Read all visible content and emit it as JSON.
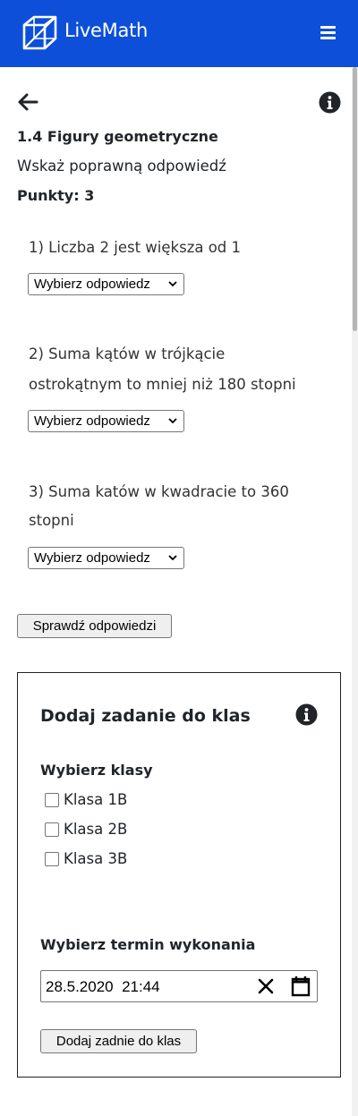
{
  "header": {
    "brand": "LiveMath"
  },
  "task": {
    "title": "1.4 Figury geometryczne",
    "instruction": "Wskaż poprawną odpowiedź",
    "points": "Punkty: 3"
  },
  "questions": [
    {
      "line1": "1) Liczba 2 jest większa od 1",
      "line2": "",
      "select": "Wybierz odpowiedz"
    },
    {
      "line1": "2) Suma kątów w trójkącie",
      "line2": "ostrokątnym to mniej niż 180 stopni",
      "select": "Wybierz odpowiedz"
    },
    {
      "line1": "3) Suma katów w kwadracie to 360",
      "line2": "stopni",
      "select": "Wybierz odpowiedz"
    }
  ],
  "check_button": "Sprawdź odpowiedzi",
  "assign": {
    "title": "Dodaj zadanie do klas",
    "classes_label": "Wybierz klasy",
    "classes": [
      {
        "label": "Klasa 1B",
        "checked": false
      },
      {
        "label": "Klasa 2B",
        "checked": false
      },
      {
        "label": "Klasa 3B",
        "checked": false
      }
    ],
    "deadline_label": "Wybierz termin wykonania",
    "deadline_value": "28.5.2020  21:44",
    "submit_button": "Dodaj zadnie do klas"
  },
  "colors": {
    "header_bg": "#0d4fd9",
    "text": "#212529"
  },
  "icons": [
    "logo-cube-icon",
    "hamburger-menu-icon",
    "back-arrow-icon",
    "info-icon",
    "chevron-down-icon",
    "clear-x-icon",
    "calendar-icon"
  ]
}
